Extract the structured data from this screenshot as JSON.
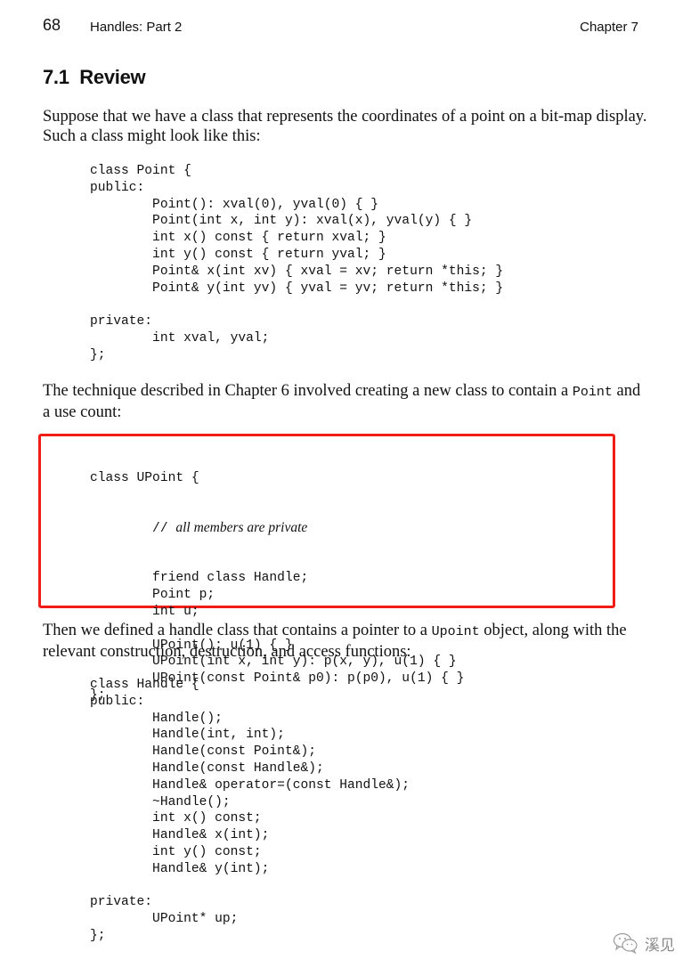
{
  "header": {
    "page_number": "68",
    "running_title": "Handles: Part 2",
    "chapter": "Chapter 7"
  },
  "section": {
    "number_title": "7.1  Review"
  },
  "paragraphs": [
    {
      "text": "Suppose that we have a class that represents the coordinates of a point on a bit-map display.  Such a class might look like this:"
    },
    {
      "code_word": "Point",
      "text_before": "The technique described in Chapter 6 involved creating a new class to contain a ",
      "text_after": " and a use count:"
    },
    {
      "text_before": "Then we defined a handle class that contains a pointer to a ",
      "code_word": "Upoint",
      "text_after": " object, along with the relevant construction, destruction, and access functions:"
    }
  ],
  "code_blocks": {
    "point_class": [
      "class Point {",
      "public:",
      "        Point(): xval(0), yval(0) { }",
      "        Point(int x, int y): xval(x), yval(y) { }",
      "        int x() const { return xval; }",
      "        int y() const { return yval; }",
      "        Point& x(int xv) { xval = xv; return *this; }",
      "        Point& y(int yv) { yval = yv; return *this; }",
      "",
      "private:",
      "        int xval, yval;",
      "};"
    ],
    "upoint_class": {
      "line0": "class UPoint {",
      "comment_prefix": "        // ",
      "comment_text": "all members are private",
      "rest": [
        "        friend class Handle;",
        "        Point p;",
        "        int u;",
        "",
        "        UPoint(): u(1) { }",
        "        UPoint(int x, int y): p(x, y), u(1) { }",
        "        UPoint(const Point& p0): p(p0), u(1) { }",
        "};"
      ]
    },
    "handle_class": [
      "class Handle {",
      "public:",
      "        Handle();",
      "        Handle(int, int);",
      "        Handle(const Point&);",
      "        Handle(const Handle&);",
      "        Handle& operator=(const Handle&);",
      "        ~Handle();",
      "        int x() const;",
      "        Handle& x(int);",
      "        int y() const;",
      "        Handle& y(int);",
      "",
      "private:",
      "        UPoint* up;",
      "};"
    ]
  },
  "highlight": {
    "color": "#f01d16",
    "target": "upoint_class"
  },
  "watermark": {
    "icon": "wechat-icon",
    "text": "溪见"
  }
}
